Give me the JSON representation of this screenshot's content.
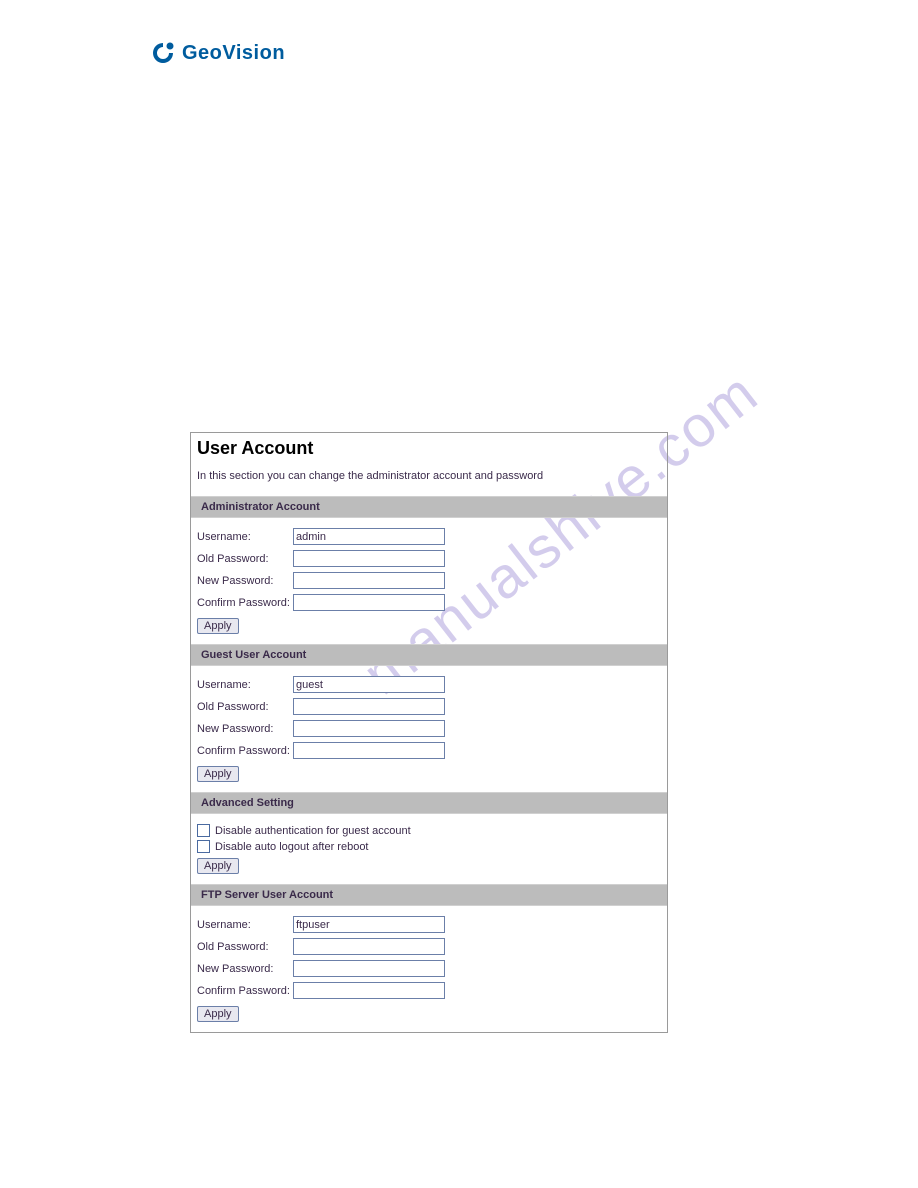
{
  "logo": {
    "text": "GeoVision"
  },
  "watermark": "manualshive.com",
  "panel": {
    "title": "User Account",
    "description": "In this section you can change the administrator account and password"
  },
  "sections": {
    "admin": {
      "header": "Administrator Account",
      "username_label": "Username:",
      "username_value": "admin",
      "old_pw_label": "Old Password:",
      "new_pw_label": "New Password:",
      "confirm_pw_label": "Confirm Password:",
      "apply": "Apply"
    },
    "guest": {
      "header": "Guest User Account",
      "username_label": "Username:",
      "username_value": "guest",
      "old_pw_label": "Old Password:",
      "new_pw_label": "New Password:",
      "confirm_pw_label": "Confirm Password:",
      "apply": "Apply"
    },
    "advanced": {
      "header": "Advanced Setting",
      "cb1_label": "Disable authentication for guest account",
      "cb2_label": "Disable auto logout after reboot",
      "apply": "Apply"
    },
    "ftp": {
      "header": "FTP Server User Account",
      "username_label": "Username:",
      "username_value": "ftpuser",
      "old_pw_label": "Old Password:",
      "new_pw_label": "New Password:",
      "confirm_pw_label": "Confirm Password:",
      "apply": "Apply"
    }
  }
}
